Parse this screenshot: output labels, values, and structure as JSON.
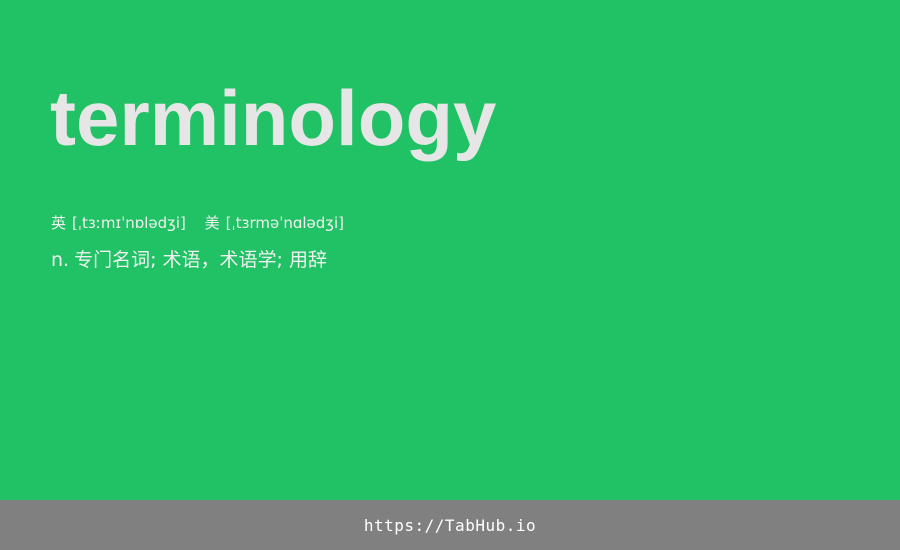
{
  "entry": {
    "word": "terminology",
    "phonetics": {
      "uk": {
        "label": "英",
        "ipa": "[ˌtɜːmɪˈnɒlədʒi]"
      },
      "us": {
        "label": "美",
        "ipa": "[ˌtɜrməˈnɑlədʒi]"
      }
    },
    "definition": {
      "pos": "n.",
      "text": "专门名词; 术语，术语学; 用辞"
    }
  },
  "footer": {
    "link_text": "https://TabHub.io"
  },
  "colors": {
    "background": "#21c165",
    "word": "#e6e6e6",
    "text": "#f0f0f0",
    "footer_bg": "#808080",
    "footer_text": "#ffffff"
  }
}
